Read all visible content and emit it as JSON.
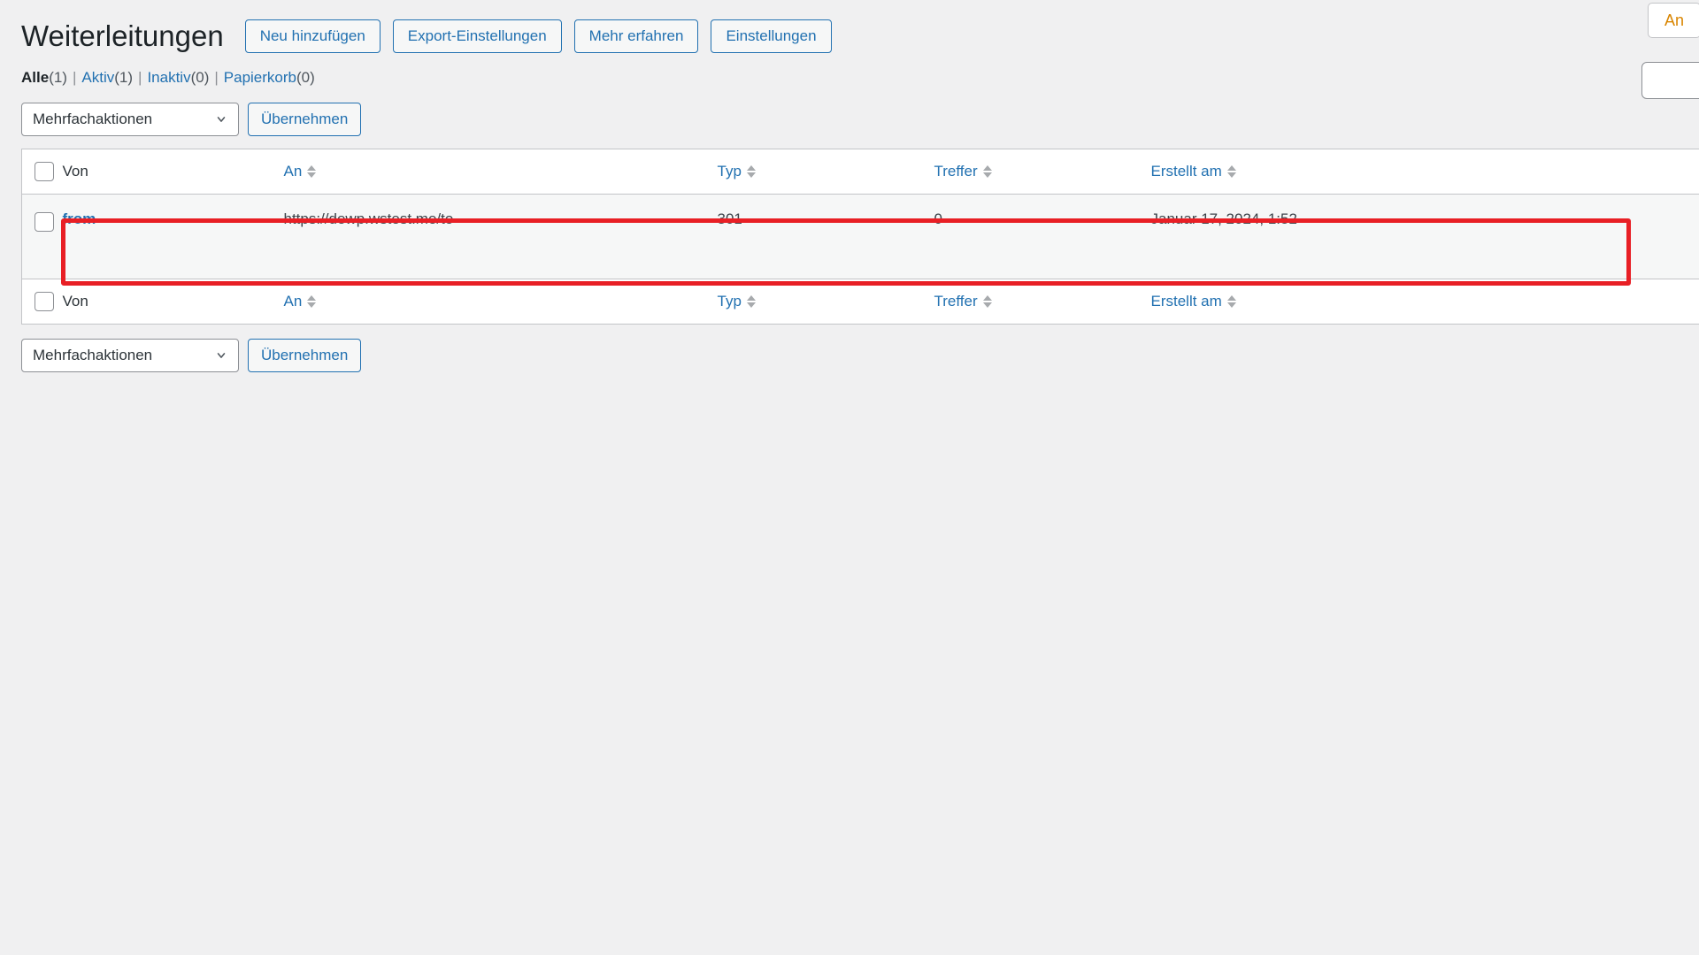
{
  "header": {
    "title": "Weiterleitungen",
    "buttons": [
      {
        "label": "Neu hinzufügen",
        "name": "add-new-button"
      },
      {
        "label": "Export-Einstellungen",
        "name": "export-settings-button"
      },
      {
        "label": "Mehr erfahren",
        "name": "learn-more-button"
      },
      {
        "label": "Einstellungen",
        "name": "settings-button"
      }
    ],
    "topright_button_label": "An",
    "search_value": "",
    "search_placeholder": ""
  },
  "views": [
    {
      "label": "Alle",
      "count": "(1)",
      "current": true
    },
    {
      "label": "Aktiv",
      "count": "(1)",
      "current": false
    },
    {
      "label": "Inaktiv",
      "count": "(0)",
      "current": false
    },
    {
      "label": "Papierkorb",
      "count": "(0)",
      "current": false
    }
  ],
  "views_separator": "|",
  "bulk": {
    "selected": "Mehrfachaktionen",
    "apply_label": "Übernehmen"
  },
  "table": {
    "columns": {
      "von": "Von",
      "an": "An",
      "typ": "Typ",
      "treffer": "Treffer",
      "erstellt": "Erstellt am"
    },
    "rows": [
      {
        "von": "from",
        "an": "https://dewp.wstest.me/to",
        "typ": "301",
        "treffer": "0",
        "erstellt": "Januar 17, 2024, 1:52"
      }
    ]
  },
  "colors": {
    "accent": "#2271b1",
    "highlight": "#e81f25",
    "page_bg": "#f0f0f1",
    "row_bg": "#f6f7f7"
  }
}
